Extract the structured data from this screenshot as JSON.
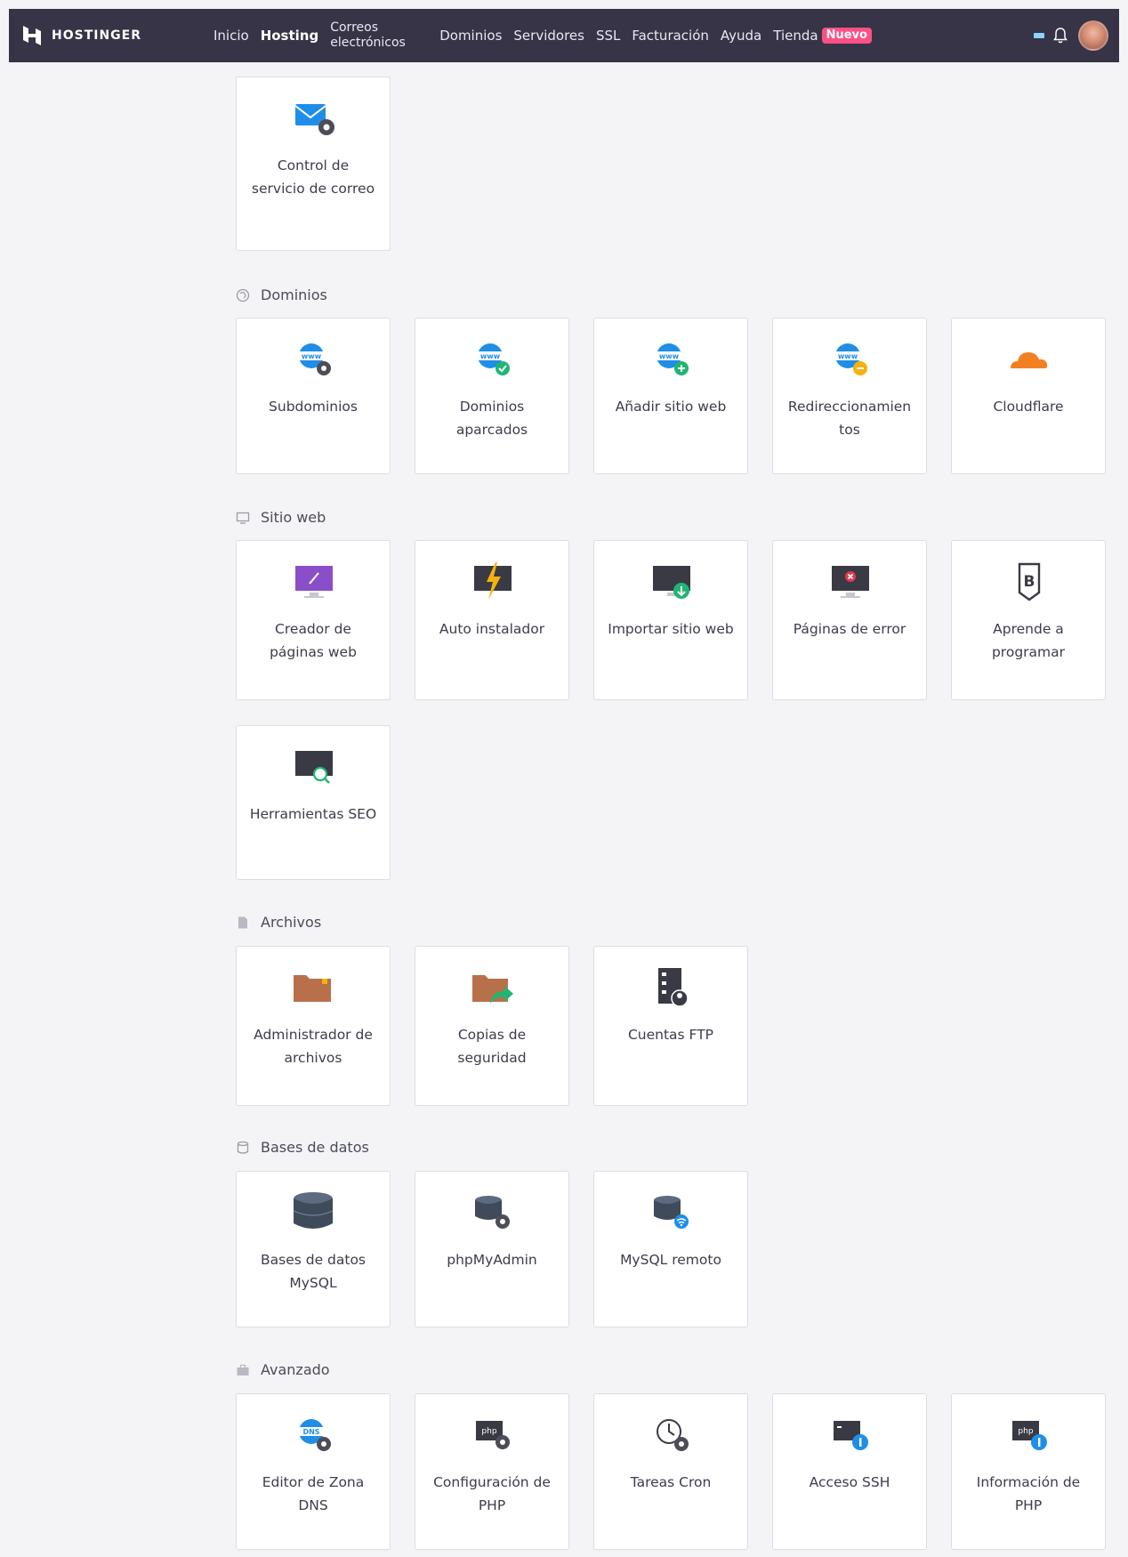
{
  "brand": {
    "name": "HOSTINGER"
  },
  "nav": {
    "items": [
      {
        "label": "Inicio"
      },
      {
        "label": "Hosting"
      },
      {
        "label": "Correos electrónicos"
      },
      {
        "label": "Dominios"
      },
      {
        "label": "Servidores"
      },
      {
        "label": "SSL"
      },
      {
        "label": "Facturación"
      },
      {
        "label": "Ayuda"
      },
      {
        "label": "Tienda"
      }
    ],
    "active": "Hosting",
    "new_badge": "Nuevo"
  },
  "sections": {
    "email": {
      "cards": [
        {
          "label": "Control de servicio de correo",
          "icon": "mail-gear-icon"
        }
      ]
    },
    "domains": {
      "title": "Dominios",
      "cards": [
        {
          "label": "Subdominios",
          "icon": "www-gear-icon"
        },
        {
          "label": "Dominios aparcados",
          "icon": "www-check-icon"
        },
        {
          "label": "Añadir sitio web",
          "icon": "www-plus-icon"
        },
        {
          "label": "Redireccionamientos",
          "icon": "www-redirect-icon"
        },
        {
          "label": "Cloudflare",
          "icon": "cloudflare-icon"
        }
      ]
    },
    "website": {
      "title": "Sitio web",
      "cards": [
        {
          "label": "Creador de páginas web",
          "icon": "website-builder-icon"
        },
        {
          "label": "Auto instalador",
          "icon": "lightning-monitor-icon"
        },
        {
          "label": "Importar sitio web",
          "icon": "import-monitor-icon"
        },
        {
          "label": "Páginas de error",
          "icon": "error-monitor-icon"
        },
        {
          "label": "Aprende a programar",
          "icon": "code-shield-icon"
        },
        {
          "label": "Herramientas SEO",
          "icon": "seo-monitor-icon"
        }
      ]
    },
    "files": {
      "title": "Archivos",
      "cards": [
        {
          "label": "Administrador de archivos",
          "icon": "folder-icon"
        },
        {
          "label": "Copias de seguridad",
          "icon": "backup-folder-icon"
        },
        {
          "label": "Cuentas FTP",
          "icon": "ftp-server-icon"
        }
      ]
    },
    "databases": {
      "title": "Bases de datos",
      "cards": [
        {
          "label": "Bases de datos MySQL",
          "icon": "database-icon"
        },
        {
          "label": "phpMyAdmin",
          "icon": "database-gear-icon"
        },
        {
          "label": "MySQL remoto",
          "icon": "database-remote-icon"
        }
      ]
    },
    "advanced": {
      "title": "Avanzado",
      "cards": [
        {
          "label": "Editor de Zona DNS",
          "icon": "dns-gear-icon"
        },
        {
          "label": "Configuración de PHP",
          "icon": "php-gear-icon"
        },
        {
          "label": "Tareas Cron",
          "icon": "clock-gear-icon"
        },
        {
          "label": "Acceso SSH",
          "icon": "terminal-icon"
        },
        {
          "label": "Información de PHP",
          "icon": "php-info-icon"
        }
      ]
    }
  },
  "colors": {
    "topbar": "#363446",
    "accent_blue": "#1f8ee8",
    "badge": "#fc5185",
    "cloudflare": "#f38020",
    "purple": "#8a4ec9",
    "folder": "#b8704a",
    "green": "#21b573",
    "red": "#e03a4f"
  }
}
